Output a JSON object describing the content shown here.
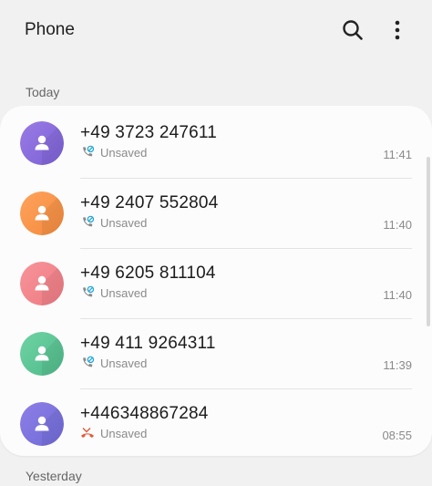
{
  "header": {
    "title": "Phone",
    "search_icon": "search-icon",
    "more_icon": "more-vert-icon"
  },
  "sections": {
    "today": "Today",
    "yesterday": "Yesterday"
  },
  "calls": [
    {
      "number": "+49 3723 247611",
      "status": "Unsaved",
      "time": "11:41",
      "call_type": "voice-call",
      "avatar_colors": [
        "#9a7be4",
        "#7b61d6"
      ]
    },
    {
      "number": "+49 2407 552804",
      "status": "Unsaved",
      "time": "11:40",
      "call_type": "voice-call",
      "avatar_colors": [
        "#ffa35c",
        "#f38a3d"
      ]
    },
    {
      "number": "+49 6205 811104",
      "status": "Unsaved",
      "time": "11:40",
      "call_type": "voice-call",
      "avatar_colors": [
        "#f7949a",
        "#ef7a82"
      ]
    },
    {
      "number": "+49 411 9264311",
      "status": "Unsaved",
      "time": "11:39",
      "call_type": "voice-call",
      "avatar_colors": [
        "#6fd3a4",
        "#4fbb8a"
      ]
    },
    {
      "number": "+446348867284",
      "status": "Unsaved",
      "time": "08:55",
      "call_type": "missed-call",
      "avatar_colors": [
        "#8f7ee6",
        "#6f6bd8"
      ]
    }
  ],
  "colors": {
    "background": "#f1f1f1",
    "card": "#fcfcfc",
    "voice_call_icon": "#8a8a8a",
    "voice_call_badge": "#1aa3d6",
    "missed_call_icon": "#e05a3a"
  }
}
